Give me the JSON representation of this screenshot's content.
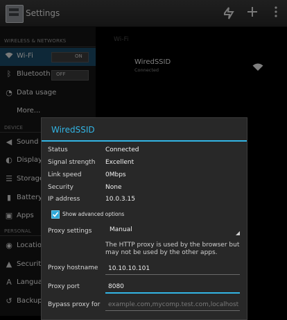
{
  "app": {
    "title": "Settings"
  },
  "sidebar": {
    "sections": [
      {
        "header": "WIRELESS & NETWORKS"
      },
      {
        "header": "DEVICE"
      },
      {
        "header": "PERSONAL"
      }
    ],
    "items": [
      {
        "label": "Wi-Fi",
        "toggle": "ON",
        "selected": true
      },
      {
        "label": "Bluetooth",
        "toggle": "OFF"
      },
      {
        "label": "Data usage"
      },
      {
        "label": "More..."
      },
      {
        "label": "Sound"
      },
      {
        "label": "Display"
      },
      {
        "label": "Storage"
      },
      {
        "label": "Battery"
      },
      {
        "label": "Apps"
      },
      {
        "label": "Location"
      },
      {
        "label": "Security"
      },
      {
        "label": "Language"
      },
      {
        "label": "Backup"
      }
    ]
  },
  "main": {
    "header": "Wi-Fi",
    "network": {
      "ssid": "WiredSSID",
      "status": "Connected"
    }
  },
  "dialog": {
    "title": "WiredSSID",
    "rows": [
      {
        "label": "Status",
        "value": "Connected"
      },
      {
        "label": "Signal strength",
        "value": "Excellent"
      },
      {
        "label": "Link speed",
        "value": "0Mbps"
      },
      {
        "label": "Security",
        "value": "None"
      },
      {
        "label": "IP address",
        "value": "10.0.3.15"
      }
    ],
    "advanced_checkbox": {
      "label": "Show advanced options",
      "checked": true
    },
    "proxy_settings": {
      "label": "Proxy settings",
      "value": "Manual"
    },
    "proxy_help": "The HTTP proxy is used by the browser but may not be used by the other apps.",
    "proxy_hostname": {
      "label": "Proxy hostname",
      "value": "10.10.10.101"
    },
    "proxy_port": {
      "label": "Proxy port",
      "value": "8080"
    },
    "bypass": {
      "label": "Bypass proxy for",
      "placeholder": "example.com,mycomp.test.com,localhost"
    }
  },
  "colors": {
    "accent": "#33b5e5",
    "selected_bg": "#1b4a66"
  }
}
